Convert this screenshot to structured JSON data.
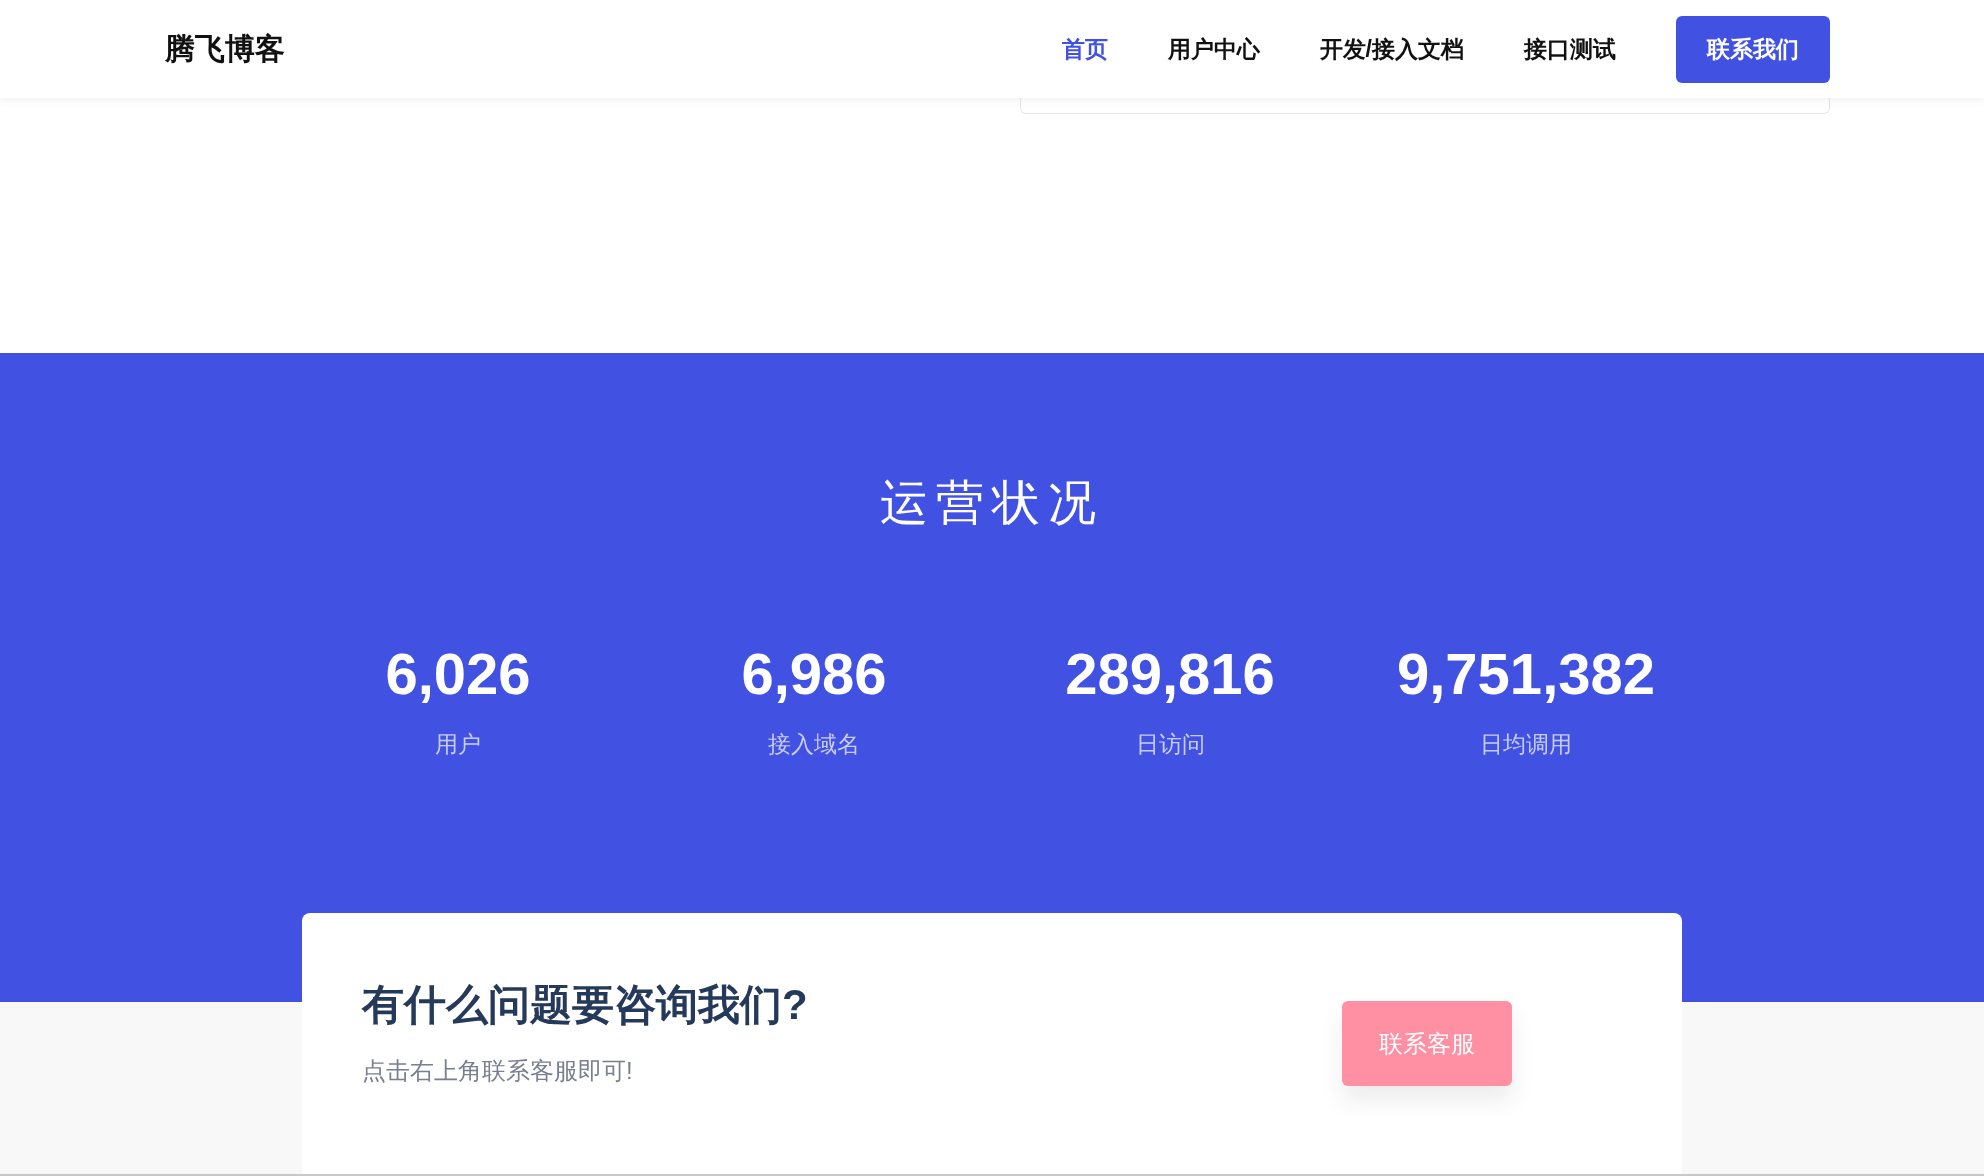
{
  "header": {
    "logo": "腾飞博客",
    "nav": [
      {
        "label": "首页",
        "selected": true
      },
      {
        "label": "用户中心",
        "selected": false
      },
      {
        "label": "开发/接入文档",
        "selected": false
      },
      {
        "label": "接口测试",
        "selected": false
      }
    ],
    "contact_button": "联系我们"
  },
  "stats": {
    "title": "运营状况",
    "items": [
      {
        "value": "6,026",
        "label": "用户"
      },
      {
        "value": "6,986",
        "label": "接入域名"
      },
      {
        "value": "289,816",
        "label": "日访问"
      },
      {
        "value": "9,751,382",
        "label": "日均调用"
      }
    ]
  },
  "cta": {
    "heading": "有什么问题要咨询我们?",
    "text": "点击右上角联系客服即可!",
    "button": "联系客服"
  }
}
